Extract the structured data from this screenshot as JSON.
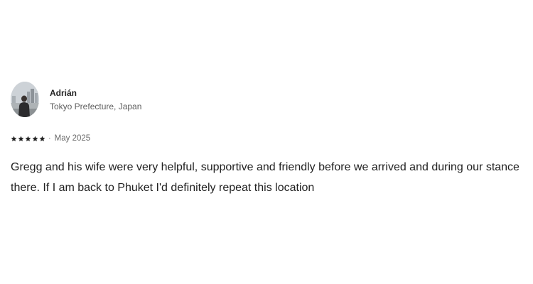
{
  "reviewer": {
    "name": "Adrián",
    "location": "Tokyo Prefecture, Japan",
    "avatar_icon": "user-photo-avatar"
  },
  "rating": {
    "stars": 5,
    "max_stars": 5,
    "star_icon": "star-icon",
    "star_color": "#222222",
    "separator": "·",
    "date": "May 2025"
  },
  "review": {
    "text": "Gregg and his wife were very helpful, supportive and friendly before we arrived and during our stance there. If I am back to Phuket I'd definitely repeat this location"
  }
}
